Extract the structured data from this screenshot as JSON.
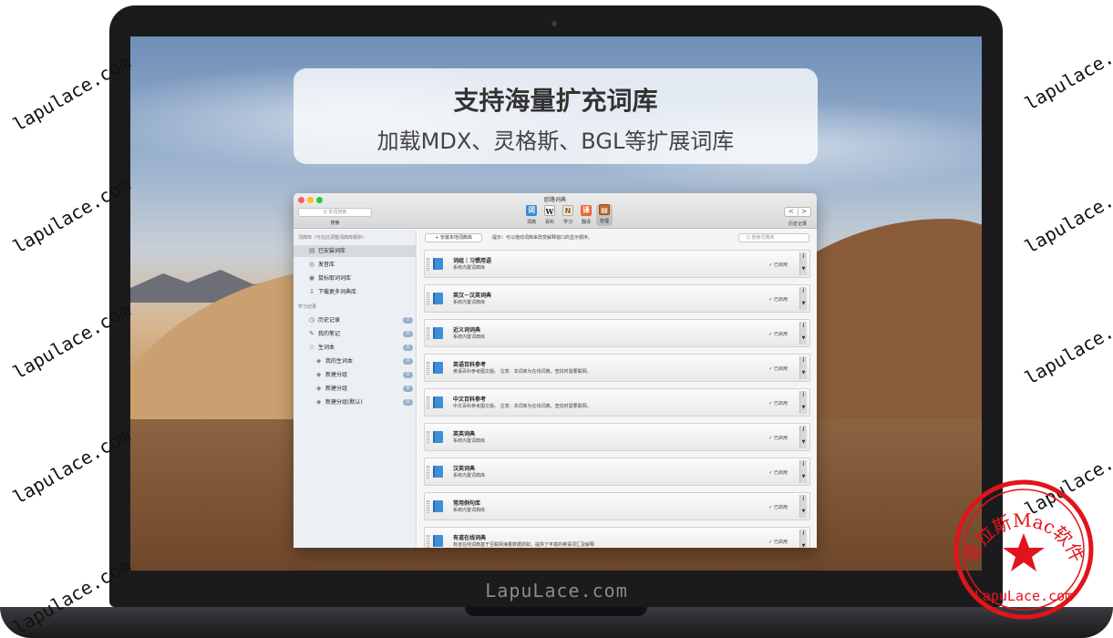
{
  "caption": {
    "title": "支持海量扩充词库",
    "subtitle": "加载MDX、灵格斯、BGL等扩展词库"
  },
  "window": {
    "title": "欧路词典",
    "search_placeholder": "Q 单词搜索",
    "search_caption": "搜索",
    "toolbar": [
      {
        "label": "词典",
        "icon": "dictionary-icon",
        "glyph": "词"
      },
      {
        "label": "百科",
        "icon": "wiki-icon",
        "glyph": "W"
      },
      {
        "label": "学习",
        "icon": "study-icon",
        "glyph": "N"
      },
      {
        "label": "翻译",
        "icon": "translate-icon",
        "glyph": "译"
      },
      {
        "label": "管理",
        "icon": "manage-icon",
        "glyph": "▤"
      }
    ],
    "history_prev": "<",
    "history_next": ">",
    "history_caption": "历史记录"
  },
  "sidebar": {
    "dict_header": "词典库（可在此调整词典库顺序）",
    "dict_items": [
      {
        "label": "已安装词库",
        "icon": "installed-icon",
        "glyph": "▤"
      },
      {
        "label": "发音库",
        "icon": "speech-icon",
        "glyph": "◎"
      },
      {
        "label": "鼠标取词词库",
        "icon": "mouse-icon",
        "glyph": "◉"
      },
      {
        "label": "下载更多词典库",
        "icon": "download-icon",
        "glyph": "⇩"
      }
    ],
    "study_header": "学习记录",
    "study_items": [
      {
        "label": "历史记录",
        "icon": "clock-icon",
        "glyph": "◷",
        "count": "7",
        "indent": false
      },
      {
        "label": "我的笔记",
        "icon": "pencil-icon",
        "glyph": "✎",
        "count": "0",
        "indent": false
      },
      {
        "label": "生词本",
        "icon": "star-icon",
        "glyph": "☆",
        "count": "0",
        "indent": false
      },
      {
        "label": "我的生词本",
        "icon": "tag-icon",
        "glyph": "◈",
        "count": "0",
        "indent": true
      },
      {
        "label": "新建分组",
        "icon": "tag-icon",
        "glyph": "◈",
        "count": "0",
        "indent": true
      },
      {
        "label": "新建分组",
        "icon": "tag-icon",
        "glyph": "◈",
        "count": "0",
        "indent": true
      },
      {
        "label": "新建分组(默认)",
        "icon": "tag-icon",
        "glyph": "◈",
        "count": "0",
        "indent": true
      }
    ]
  },
  "main": {
    "add_button": "+ 安装本地词典库",
    "hint": "提示：可以拖动词典来改变解释窗口的显示顺序。",
    "search_placeholder": "Q 搜索词典库",
    "dictionaries": [
      {
        "name": "词组｜习惯用语",
        "desc": "系统内置词典库",
        "status": "✓ 已启用"
      },
      {
        "name": "英汉－汉英词典",
        "desc": "系统内置词典库",
        "status": "✓ 已启用"
      },
      {
        "name": "近义词词典",
        "desc": "系统内置词典库",
        "status": "✓ 已启用"
      },
      {
        "name": "英语百科参考",
        "desc": "英语百科参考图文版。 注意：本词库为在线词典，查找时需要联网。",
        "status": "✓ 已启用"
      },
      {
        "name": "中文百科参考",
        "desc": "中文百科参考图文版。 注意：本词库为在线词典，查找时需要联网。",
        "status": "✓ 已启用"
      },
      {
        "name": "英英词典",
        "desc": "系统内置词典库",
        "status": "✓ 已启用"
      },
      {
        "name": "汉英词典",
        "desc": "系统内置词典库",
        "status": "✓ 已启用"
      },
      {
        "name": "常用例句库",
        "desc": "系统内置词典库",
        "status": "✓ 已启用"
      },
      {
        "name": "有道在线词典",
        "desc": "有道在线词典基于互联网海量数据抓取，提供了丰富的英语词汇及解释",
        "status": "✓ 已启用"
      }
    ],
    "info_glyph": "i",
    "arrow_glyph": "▼"
  },
  "laptop": {
    "chin_brand": "LapuLace.com"
  },
  "watermarks": {
    "text": "lapulace.com"
  },
  "stamp": {
    "arc_text": "普拉斯Mac软件",
    "bottom_text": "LapuLace.com"
  }
}
